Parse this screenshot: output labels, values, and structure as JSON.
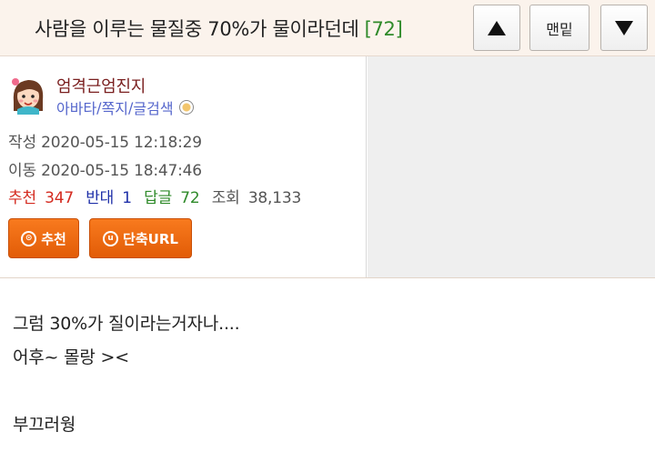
{
  "header": {
    "title": "사람을 이루는 물질중 70%가 물이라던데",
    "comment_count": "[72]",
    "bottom_label": "맨밑",
    "up_icon": "triangle-up-icon",
    "down_icon": "triangle-down-icon"
  },
  "author": {
    "name": "엄격근엄진지",
    "links": [
      "아바타",
      "쪽지",
      "글검색"
    ],
    "link_separator": "/"
  },
  "meta": {
    "created_label": "작성",
    "created": "2020-05-15 12:18:29",
    "moved_label": "이동",
    "moved": "2020-05-15 18:47:46"
  },
  "stats": {
    "recommend_label": "추천",
    "recommend": "347",
    "oppose_label": "반대",
    "oppose": "1",
    "reply_label": "답글",
    "reply": "72",
    "views_label": "조회",
    "views": "38,133"
  },
  "actions": {
    "recommend_button": "추천",
    "recommend_icon_glyph": "⊙",
    "shorturl_button": "단축URL",
    "shorturl_icon_glyph": "u"
  },
  "content": {
    "lines": [
      "그럼 30%가 질이라는거자나....",
      "어후~ 몰랑 ><",
      "",
      "부끄러웡"
    ]
  },
  "colors": {
    "header_bg": "#fbf3ec",
    "author": "#7a1f1f",
    "link": "#5566cc",
    "recommend": "#d42a1f",
    "oppose": "#1e2fa8",
    "reply": "#2f8a2a",
    "button_orange": "#f07010"
  }
}
